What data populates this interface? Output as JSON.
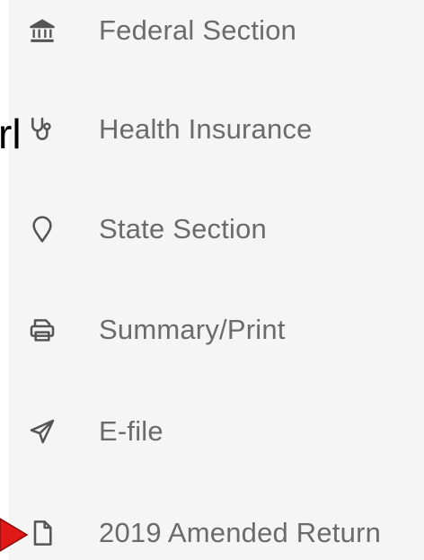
{
  "menu": {
    "items": [
      {
        "label": "Federal Section",
        "icon": "bank-icon"
      },
      {
        "label": "Health Insurance",
        "icon": "stethoscope-icon"
      },
      {
        "label": "State Section",
        "icon": "location-pin-icon"
      },
      {
        "label": "Summary/Print",
        "icon": "printer-icon"
      },
      {
        "label": "E-file",
        "icon": "paper-plane-icon"
      },
      {
        "label": "2019 Amended Return",
        "icon": "document-icon"
      }
    ]
  },
  "overlay": {
    "cut_text": "rl",
    "arrow_color": "#e01818"
  },
  "colors": {
    "panel_bg": "#f5f5f5",
    "label": "#6b6b6b",
    "icon": "#555555"
  }
}
